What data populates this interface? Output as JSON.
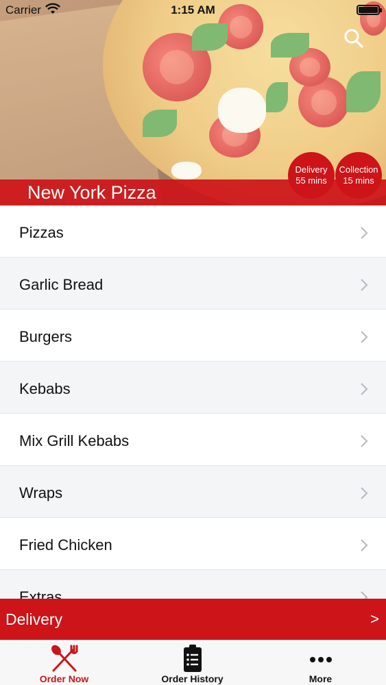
{
  "status_bar": {
    "carrier": "Carrier",
    "time": "1:15 AM"
  },
  "header": {
    "restaurant_name": "New York Pizza",
    "search_icon": "search-icon",
    "badges": [
      {
        "label": "Delivery",
        "value": "55 mins"
      },
      {
        "label": "Collection",
        "value": "15 mins"
      }
    ]
  },
  "menu": {
    "items": [
      {
        "label": "Pizzas"
      },
      {
        "label": "Garlic Bread"
      },
      {
        "label": "Burgers"
      },
      {
        "label": "Kebabs"
      },
      {
        "label": "Mix Grill Kebabs"
      },
      {
        "label": "Wraps"
      },
      {
        "label": "Fried Chicken"
      },
      {
        "label": "Extras"
      }
    ],
    "chevron_icon": "chevron-right-icon"
  },
  "delivery_bar": {
    "label": "Delivery",
    "arrow": ">"
  },
  "tab_bar": {
    "tabs": [
      {
        "label": "Order Now",
        "icon": "fork-knife-icon",
        "active": true
      },
      {
        "label": "Order History",
        "icon": "clipboard-list-icon",
        "active": false
      },
      {
        "label": "More",
        "icon": "more-dots-icon",
        "active": false
      }
    ]
  },
  "colors": {
    "brand_red": "#cd1418",
    "row_alt": "#f4f5f7",
    "chevron": "#b9bcc2"
  }
}
